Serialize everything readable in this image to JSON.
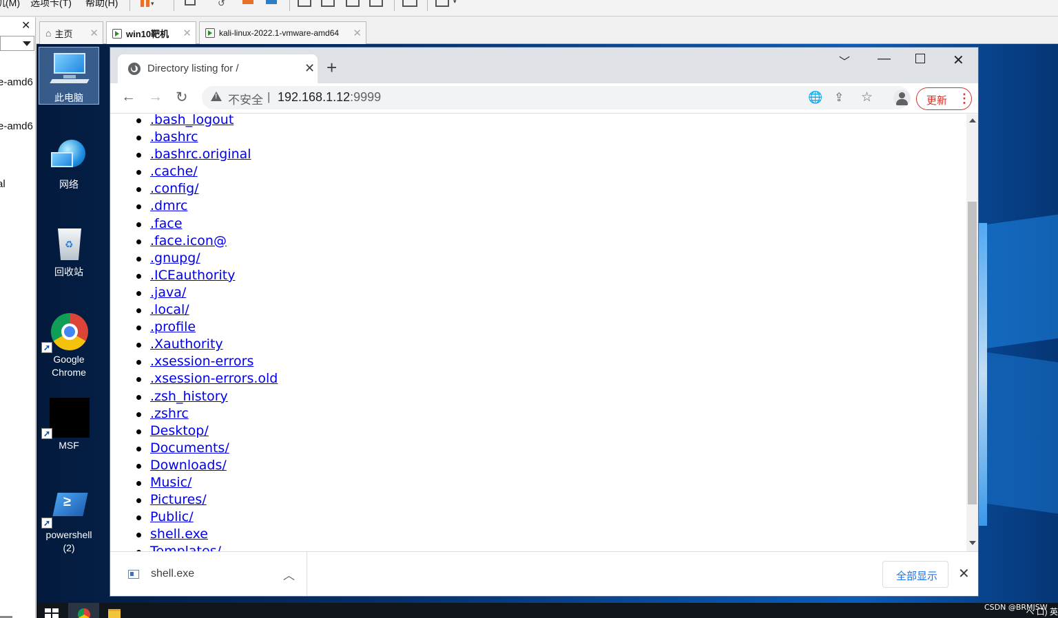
{
  "host": {
    "menu": [
      "机(M)",
      "选项卡(T)",
      "帮助(H)"
    ],
    "sidebar_items": [
      "e-amd6",
      "e-amd6",
      "al"
    ],
    "sidebar_edge_text": "p",
    "tabs": [
      {
        "label": "主页",
        "icon": "home-icon"
      },
      {
        "label": "win10靶机",
        "icon": "vm-icon"
      },
      {
        "label": "kali-linux-2022.1-vmware-amd64",
        "icon": "vm-icon"
      }
    ]
  },
  "desktop": {
    "icons": [
      {
        "label": "此电脑",
        "icon": "computer-icon"
      },
      {
        "label": "网络",
        "icon": "network-icon"
      },
      {
        "label": "回收站",
        "icon": "recycle-bin-icon"
      },
      {
        "label": "Google Chrome",
        "icon": "chrome-icon"
      },
      {
        "label": "MSF",
        "icon": "msf-icon"
      },
      {
        "label": "powershell (2)",
        "icon": "powershell-icon"
      }
    ],
    "watermark": "CSDN @BRMJSW",
    "tray_text": "へ 口) 英"
  },
  "browser": {
    "tab_title": "Directory listing for /",
    "address": {
      "security_label": "不安全",
      "separator": "|",
      "host": "192.168.1.12",
      "port": ":9999"
    },
    "update_label": "更新",
    "files": [
      ".bash_logout",
      ".bashrc",
      ".bashrc.original",
      ".cache/",
      ".config/",
      ".dmrc",
      ".face",
      ".face.icon@",
      ".gnupg/",
      ".ICEauthority",
      ".java/",
      ".local/",
      ".profile",
      ".Xauthority",
      ".xsession-errors",
      ".xsession-errors.old",
      ".zsh_history",
      ".zshrc",
      "Desktop/",
      "Documents/",
      "Downloads/",
      "Music/",
      "Pictures/",
      "Public/",
      "shell.exe",
      "Templates/"
    ],
    "download": {
      "file_name": "shell.exe",
      "show_all_label": "全部显示"
    }
  },
  "colors": {
    "link": "#0000ee",
    "update_red": "#d93025",
    "show_all_blue": "#1a73e8",
    "tabstrip": "#dee1e6"
  }
}
